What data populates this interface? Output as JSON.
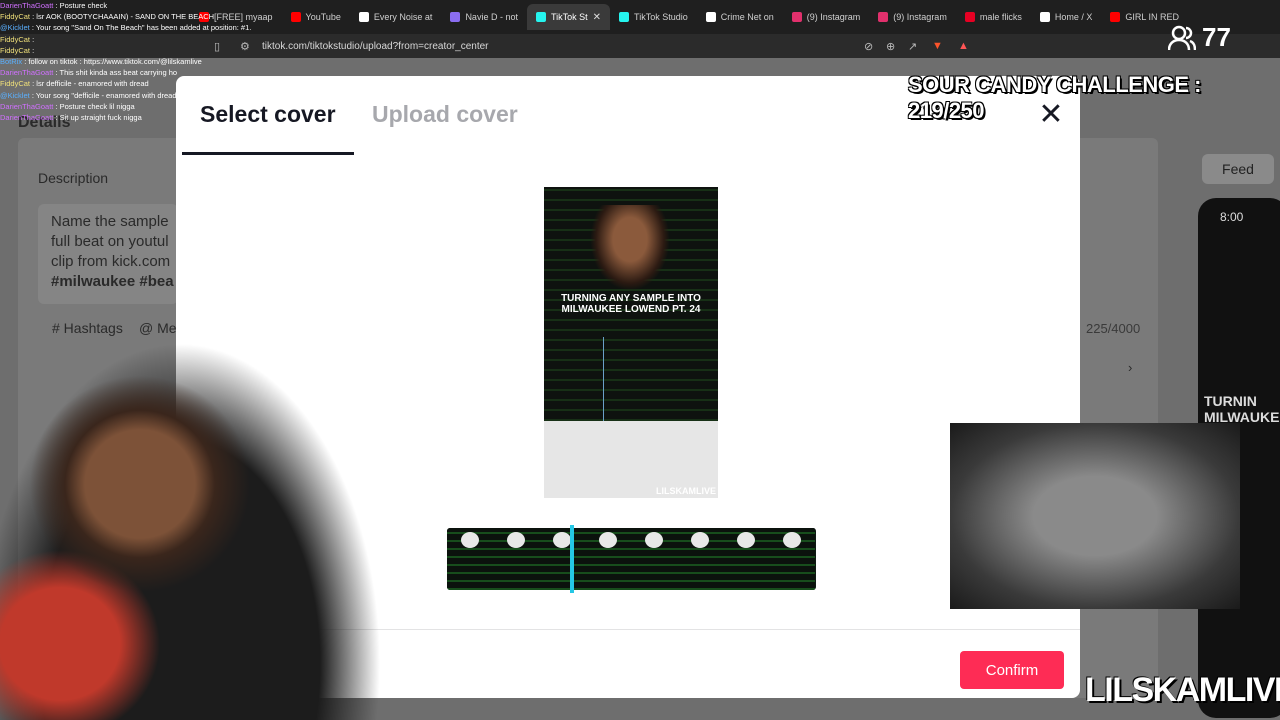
{
  "browser": {
    "tabs": [
      {
        "label": "[FREE] myaap",
        "color": "#ff0000",
        "active": false
      },
      {
        "label": "YouTube",
        "color": "#ff0000",
        "active": false
      },
      {
        "label": "Every Noise at",
        "color": "#ffffff",
        "active": false
      },
      {
        "label": "Navie D - not",
        "color": "#8a6df0",
        "active": false
      },
      {
        "label": "TikTok St",
        "color": "#25f4ee",
        "active": true
      },
      {
        "label": "TikTok Studio",
        "color": "#25f4ee",
        "active": false
      },
      {
        "label": "Crime Net on",
        "color": "#ffffff",
        "active": false
      },
      {
        "label": "(9) Instagram",
        "color": "#e1306c",
        "active": false
      },
      {
        "label": "(9) Instagram",
        "color": "#e1306c",
        "active": false
      },
      {
        "label": "male flicks",
        "color": "#e60023",
        "active": false
      },
      {
        "label": "Home / X",
        "color": "#ffffff",
        "active": false
      },
      {
        "label": "GIRL IN RED",
        "color": "#ff0000",
        "active": false
      }
    ],
    "url": "tiktok.com/tiktokstudio/upload?from=creator_center"
  },
  "background_page": {
    "details": "Details",
    "description_label": "Description",
    "description_lines": [
      "Name the sample",
      "full beat on youtul",
      "clip from kick.com",
      "#milwaukee #bea"
    ],
    "hashtags_label": "# Hashtags",
    "mention_label": "@ Me",
    "char_count": "225/4000",
    "feed_tab": "Feed",
    "phone_time": "8:00",
    "phone_caption": "TURNIN MILWAUKE"
  },
  "modal": {
    "tab_select": "Select cover",
    "tab_upload": "Upload cover",
    "close_icon": "close-icon",
    "preview_caption": "TURNING ANY SAMPLE INTO MILWAUKEE LOWEND PT. 24",
    "preview_watermark": "LILSKAMLIVE",
    "confirm_label": "Confirm",
    "accent": "#fe2c55",
    "scrubber_color": "#25c8e6"
  },
  "chat": [
    {
      "user": "DarienThaGoatt",
      "msg": ": Posture check",
      "color": "u2"
    },
    {
      "user": "FiddyCat",
      "msg": ": lsr AOK (BOOTYCHAAAIN) - SAND ON THE BEACH",
      "color": "u1"
    },
    {
      "user": "@Kicklet",
      "msg": ": Your song \"Sand On The Beach\" has been added at position: #1.",
      "color": "u3"
    },
    {
      "user": "FiddyCat",
      "msg": ":",
      "color": "u1"
    },
    {
      "user": "FiddyCat",
      "msg": ":",
      "color": "u1"
    },
    {
      "user": "BotRix",
      "msg": ": follow on tiktok : https://www.tiktok.com/@lilskamlive",
      "color": "u3"
    },
    {
      "user": "DarienThaGoatt",
      "msg": ": This shit kinda ass beat carrying ho",
      "color": "u2"
    },
    {
      "user": "FiddyCat",
      "msg": ": lsr defficile - enamored with dread",
      "color": "u1"
    },
    {
      "user": "@Kicklet",
      "msg": ": Your song \"defficile - enamored with dread (prod. 1k)\" has been added at position: #2.",
      "color": "u3"
    },
    {
      "user": "DarienThaGoatt",
      "msg": ": Posture check lil nigga",
      "color": "u2"
    },
    {
      "user": "DarienThaGoatt",
      "msg": ": Sit up straight fuck nigga",
      "color": "u2"
    }
  ],
  "overlay": {
    "challenge": "SOUR CANDY CHALLENGE : 219/250",
    "viewers": "77",
    "brand": "LILSKAMLIVE"
  }
}
